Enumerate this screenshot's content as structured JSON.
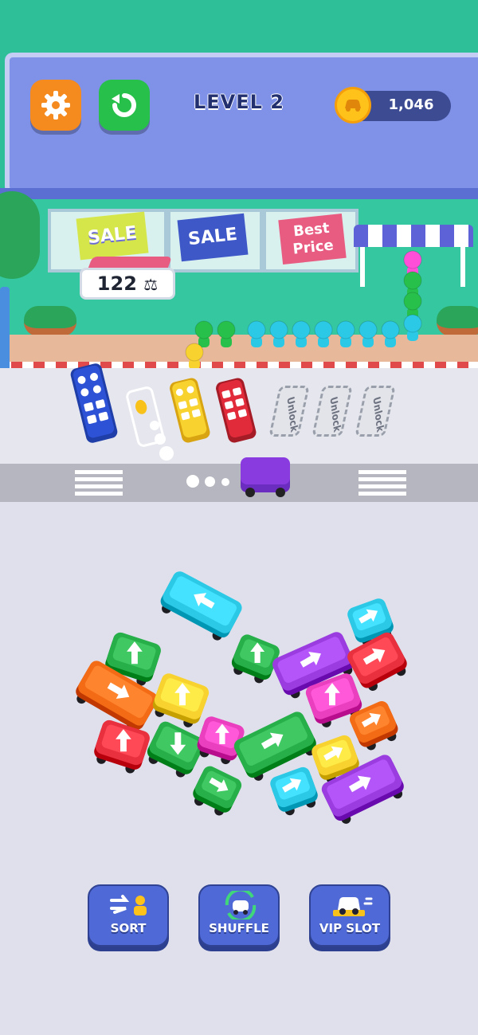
{
  "header": {
    "level_text": "LEVEL 2",
    "coins": "1,046",
    "settings_icon": "gear-icon",
    "restart_icon": "restart-icon",
    "coin_icon": "car-coin-icon"
  },
  "store": {
    "signs": [
      "SALE",
      "SALE",
      "Best Price"
    ],
    "passenger_count": "122"
  },
  "slots": {
    "locked_label": "Unlock"
  },
  "board": {
    "vehicles": [
      {
        "kind": "bus",
        "color": "#2bc9e6",
        "arrow": "up-left"
      },
      {
        "kind": "car",
        "color": "#2bc9e6",
        "arrow": "up-right"
      },
      {
        "kind": "car",
        "color": "#27b04a",
        "arrow": "up"
      },
      {
        "kind": "car",
        "color": "#27b04a",
        "arrow": "up"
      },
      {
        "kind": "bus",
        "color": "#9a3ce0",
        "arrow": "up-right"
      },
      {
        "kind": "car",
        "color": "#e9303e",
        "arrow": "up-right"
      },
      {
        "kind": "bus",
        "color": "#f36b15",
        "arrow": "down-right"
      },
      {
        "kind": "car",
        "color": "#f8d22e",
        "arrow": "up"
      },
      {
        "kind": "car",
        "color": "#ea3fbf",
        "arrow": "up"
      },
      {
        "kind": "car",
        "color": "#f36b15",
        "arrow": "up-right"
      },
      {
        "kind": "car",
        "color": "#e9303e",
        "arrow": "up"
      },
      {
        "kind": "car",
        "color": "#27b04a",
        "arrow": "down"
      },
      {
        "kind": "car",
        "color": "#ea3fbf",
        "arrow": "up"
      },
      {
        "kind": "bus",
        "color": "#27b04a",
        "arrow": "up-right"
      },
      {
        "kind": "car",
        "color": "#f8d22e",
        "arrow": "up-right"
      },
      {
        "kind": "car",
        "color": "#27b04a",
        "arrow": "down-right"
      },
      {
        "kind": "car",
        "color": "#2bc9e6",
        "arrow": "up-right"
      },
      {
        "kind": "bus",
        "color": "#9a3ce0",
        "arrow": "up-right"
      }
    ]
  },
  "toolbar": {
    "sort_label": "SORT",
    "shuffle_label": "SHUFFLE",
    "vip_label": "VIP SLOT",
    "sort_icon": "sort-icon",
    "shuffle_icon": "shuffle-icon",
    "vip_icon": "vip-car-icon"
  },
  "colors": {
    "blue_bus": "#2d52d6",
    "yellow_bus": "#f8d22e",
    "red_bus": "#e22b3a",
    "purple_bus": "#8a3be0",
    "brand_blue": "#4f6ad6",
    "orange_button": "#f58a1f",
    "green_button": "#27c04a"
  }
}
